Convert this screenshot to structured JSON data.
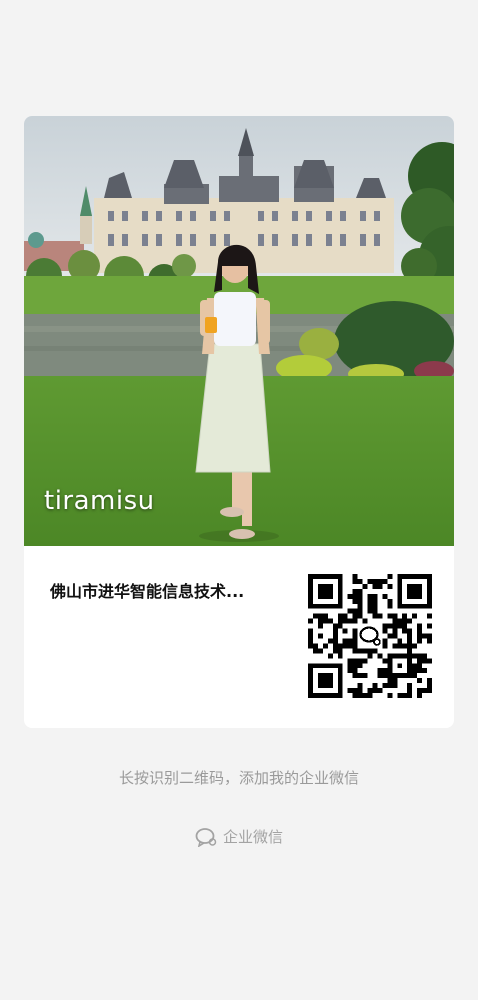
{
  "card": {
    "photo_caption": "tiramisu",
    "org_name": "佛山市进华智能信息技术..."
  },
  "hint": "长按识别二维码，添加我的企业微信",
  "brand": {
    "label": "企业微信",
    "icon": "wecom-logo-icon"
  }
}
